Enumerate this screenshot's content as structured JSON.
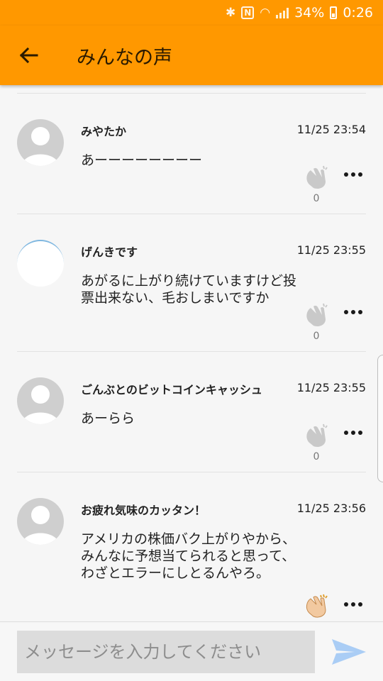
{
  "status_bar": {
    "battery": "34%",
    "time": "0:26"
  },
  "header": {
    "title": "みんなの声",
    "back_icon": "arrow-left-icon"
  },
  "comments": [
    {
      "name": "みやたか",
      "time": "11/25 23:54",
      "text": "あーーーーーーーー",
      "claps": "0",
      "clapped": false
    },
    {
      "name": "げんきです",
      "time": "11/25 23:55",
      "text": "あがるに上がり続けていますけど投票出来ない、毛おしまいですか",
      "claps": "0",
      "clapped": false
    },
    {
      "name": "ごんぶとのビットコインキャッシュ",
      "time": "11/25 23:55",
      "text": "あーらら",
      "claps": "0",
      "clapped": false
    },
    {
      "name": "お疲れ気味のカッタン！",
      "time": "11/25 23:56",
      "text": "アメリカの株価バク上がりやから、みんなに予想当てられると思って、わざとエラーにしとるんやろ。",
      "claps": "",
      "clapped": true
    }
  ],
  "composer": {
    "placeholder": "メッセージを入力してください",
    "send_icon": "send-icon"
  },
  "colors": {
    "accent": "#ff9800",
    "send": "#aacdf5",
    "clap_active": "#f2c9a0",
    "clap_inactive": "#c9c9c9"
  }
}
